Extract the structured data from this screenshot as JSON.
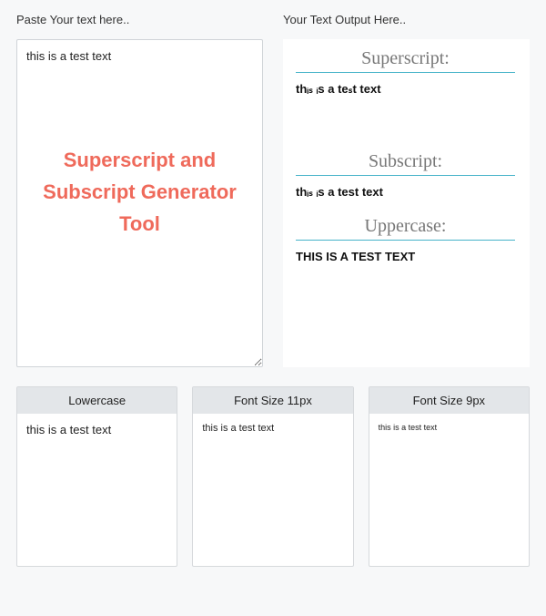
{
  "input": {
    "label": "Paste Your text here..",
    "value": "this is a test text",
    "watermark": "Superscript and Subscript Generator Tool"
  },
  "output": {
    "label": "Your Text Output Here..",
    "sections": {
      "superscript": {
        "title": "Superscript:",
        "text": "thᵢₛ ᵢs a teₛt text"
      },
      "subscript": {
        "title": "Subscript:",
        "text": "thᵢₛ ᵢs a test text"
      },
      "uppercase": {
        "title": "Uppercase:",
        "text": "THIS IS A TEST TEXT"
      }
    }
  },
  "cards": {
    "lowercase": {
      "title": "Lowercase",
      "text": "this is a test text"
    },
    "fs11": {
      "title": "Font Size 11px",
      "text": "this is a test text"
    },
    "fs9": {
      "title": "Font Size 9px",
      "text": "this is a test text"
    }
  }
}
